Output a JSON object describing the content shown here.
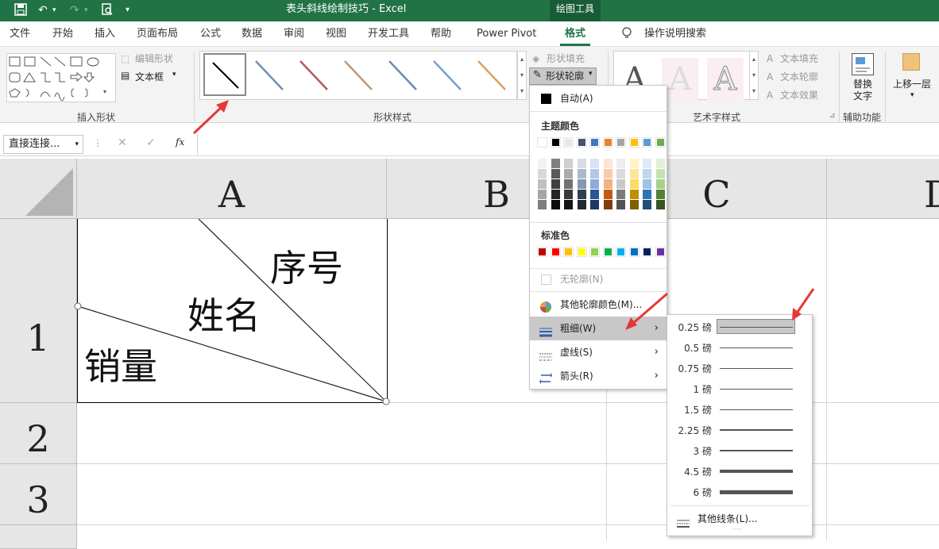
{
  "titlebar": {
    "doc_title": "表头斜线绘制技巧  -  Excel",
    "context_tab": "绘图工具"
  },
  "tabs": [
    "文件",
    "开始",
    "插入",
    "页面布局",
    "公式",
    "数据",
    "审阅",
    "视图",
    "开发工具",
    "帮助",
    "Power Pivot",
    "格式"
  ],
  "active_tab": "格式",
  "tell_me": "操作说明搜索",
  "ribbon": {
    "insert_shapes": {
      "label": "插入形状",
      "edit_shape": "编辑形状",
      "textbox": "文本框"
    },
    "shape_styles": {
      "label": "形状样式",
      "fill": "形状填充",
      "outline": "形状轮廓"
    },
    "wordart": {
      "label": "艺术字样式",
      "text_fill": "文本填充",
      "text_outline": "文本轮廓",
      "text_effect": "文本效果",
      "sample": "A"
    },
    "accessibility": {
      "label": "辅助功能",
      "alt_text_line1": "替换",
      "alt_text_line2": "文字"
    },
    "arrange": {
      "bring_forward": "上移一层"
    }
  },
  "formula_bar": {
    "name_box": "直接连接...",
    "fx": "fx"
  },
  "grid": {
    "columns": [
      "A",
      "B",
      "C",
      "D"
    ],
    "rows": [
      "1",
      "2",
      "3"
    ],
    "cell_text": {
      "seq": "序号",
      "name": "姓名",
      "sales": "销量"
    }
  },
  "outline_menu": {
    "auto": "自动(A)",
    "theme_colors_title": "主题颜色",
    "theme_row": [
      "#ffffff",
      "#000000",
      "#e7e6e6",
      "#44546a",
      "#4472c4",
      "#ed7d31",
      "#a5a5a5",
      "#ffc000",
      "#5b9bd5",
      "#70ad47"
    ],
    "theme_shades": [
      [
        "#f2f2f2",
        "#7f7f7f",
        "#d0cece",
        "#d6dce4",
        "#d9e2f3",
        "#fbe5d5",
        "#ededed",
        "#fff2cc",
        "#deebf6",
        "#e2efd9"
      ],
      [
        "#d8d8d8",
        "#595959",
        "#aeaaaa",
        "#adb9ca",
        "#b4c6e7",
        "#f7cbac",
        "#dbdbdb",
        "#fee599",
        "#bdd7ee",
        "#c5e0b3"
      ],
      [
        "#bfbfbf",
        "#3f3f3f",
        "#757070",
        "#8496b0",
        "#8eaadb",
        "#f4b183",
        "#c9c9c9",
        "#ffd965",
        "#9dc3e6",
        "#a8d08d"
      ],
      [
        "#a5a5a5",
        "#262626",
        "#3a3838",
        "#323f4f",
        "#2f5496",
        "#c55a11",
        "#7b7b7b",
        "#bf8f00",
        "#2e75b5",
        "#538135"
      ],
      [
        "#7f7f7f",
        "#0c0c0c",
        "#171616",
        "#222a35",
        "#1f3864",
        "#833c0b",
        "#525252",
        "#7f6000",
        "#1e4e79",
        "#375623"
      ]
    ],
    "standard_colors_title": "标准色",
    "standard_colors": [
      "#c00000",
      "#ff0000",
      "#ffc000",
      "#ffff00",
      "#92d050",
      "#00b050",
      "#00b0f0",
      "#0070c0",
      "#002060",
      "#7030a0"
    ],
    "no_outline": "无轮廓(N)",
    "more_colors": "其他轮廓颜色(M)...",
    "weight": "粗细(W)",
    "dashes": "虚线(S)",
    "arrows": "箭头(R)"
  },
  "weight_submenu": {
    "items": [
      {
        "label": "0.25 磅",
        "pt": 0.25
      },
      {
        "label": "0.5 磅",
        "pt": 0.5
      },
      {
        "label": "0.75 磅",
        "pt": 0.75
      },
      {
        "label": "1 磅",
        "pt": 1
      },
      {
        "label": "1.5 磅",
        "pt": 1.5
      },
      {
        "label": "2.25 磅",
        "pt": 2.25
      },
      {
        "label": "3 磅",
        "pt": 3
      },
      {
        "label": "4.5 磅",
        "pt": 4.5
      },
      {
        "label": "6 磅",
        "pt": 6
      }
    ],
    "selected_index": 0,
    "more_lines": "其他线条(L)..."
  },
  "colors": {
    "excel_green": "#217346",
    "arrow_red": "#e53935"
  }
}
